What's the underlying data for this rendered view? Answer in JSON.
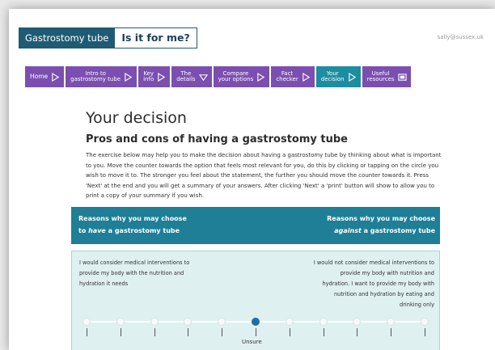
{
  "header": {
    "brand_primary": "Gastrostomy tube",
    "brand_secondary": "Is it for me?",
    "user_email": "sally@sussex.uk"
  },
  "nav": [
    {
      "label": "Home",
      "icon": "play-icon",
      "active": false
    },
    {
      "label": "Intro to\ngastrostomy tube",
      "icon": "play-icon",
      "active": false
    },
    {
      "label": "Key\ninfo",
      "icon": "play-icon",
      "active": false
    },
    {
      "label": "The\ndetails",
      "icon": "chevron-down-icon",
      "active": false
    },
    {
      "label": "Compare\nyour options",
      "icon": "play-icon",
      "active": false
    },
    {
      "label": "Fact\nchecker",
      "icon": "play-icon",
      "active": false
    },
    {
      "label": "Your\ndecision",
      "icon": "play-icon",
      "active": true
    },
    {
      "label": "Useful\nresources",
      "icon": "resources-icon",
      "active": false
    }
  ],
  "main": {
    "title": "Your decision",
    "subtitle": "Pros and cons of having a gastrostomy tube",
    "intro": "The exercise below may help you to make the decision about having a gastrostomy tube by thinking about what is important to you. Move the counter towards the option that feels most relevant for you, do this by clicking or tapping on the circle you wish to move it to. The stronger you feel about the statement, the further you should move the counter towards it. Press 'Next' at the end and you will get a summary of your answers. After clicking 'Next' a 'print' button will show to allow you to print a copy of your summary if you wish."
  },
  "reasons": {
    "left_line1": "Reasons why you may choose",
    "left_pre": "to ",
    "left_em": "have",
    "left_post": " a gastrostomy tube",
    "right_line1": "Reasons why you may choose",
    "right_em": "against",
    "right_post": " a gastrostomy tube"
  },
  "statement": {
    "left": "I would consider medical interventions to provide my body with the nutrition and hydration it needs",
    "right": "I would not consider medical interventions to provide my body with nutrition and hydration. I want to provide my body with nutrition and hydration by eating and drinking only",
    "scale_label": "Unsure",
    "selected_index": 5,
    "num_positions": 11
  },
  "colors": {
    "brand": "#1f5b74",
    "nav": "#7b4fb0",
    "nav_active": "#1d8da0",
    "reasons_bar": "#1e7f96",
    "panel": "#dff0f1",
    "selected_dot": "#1e6fa8"
  }
}
